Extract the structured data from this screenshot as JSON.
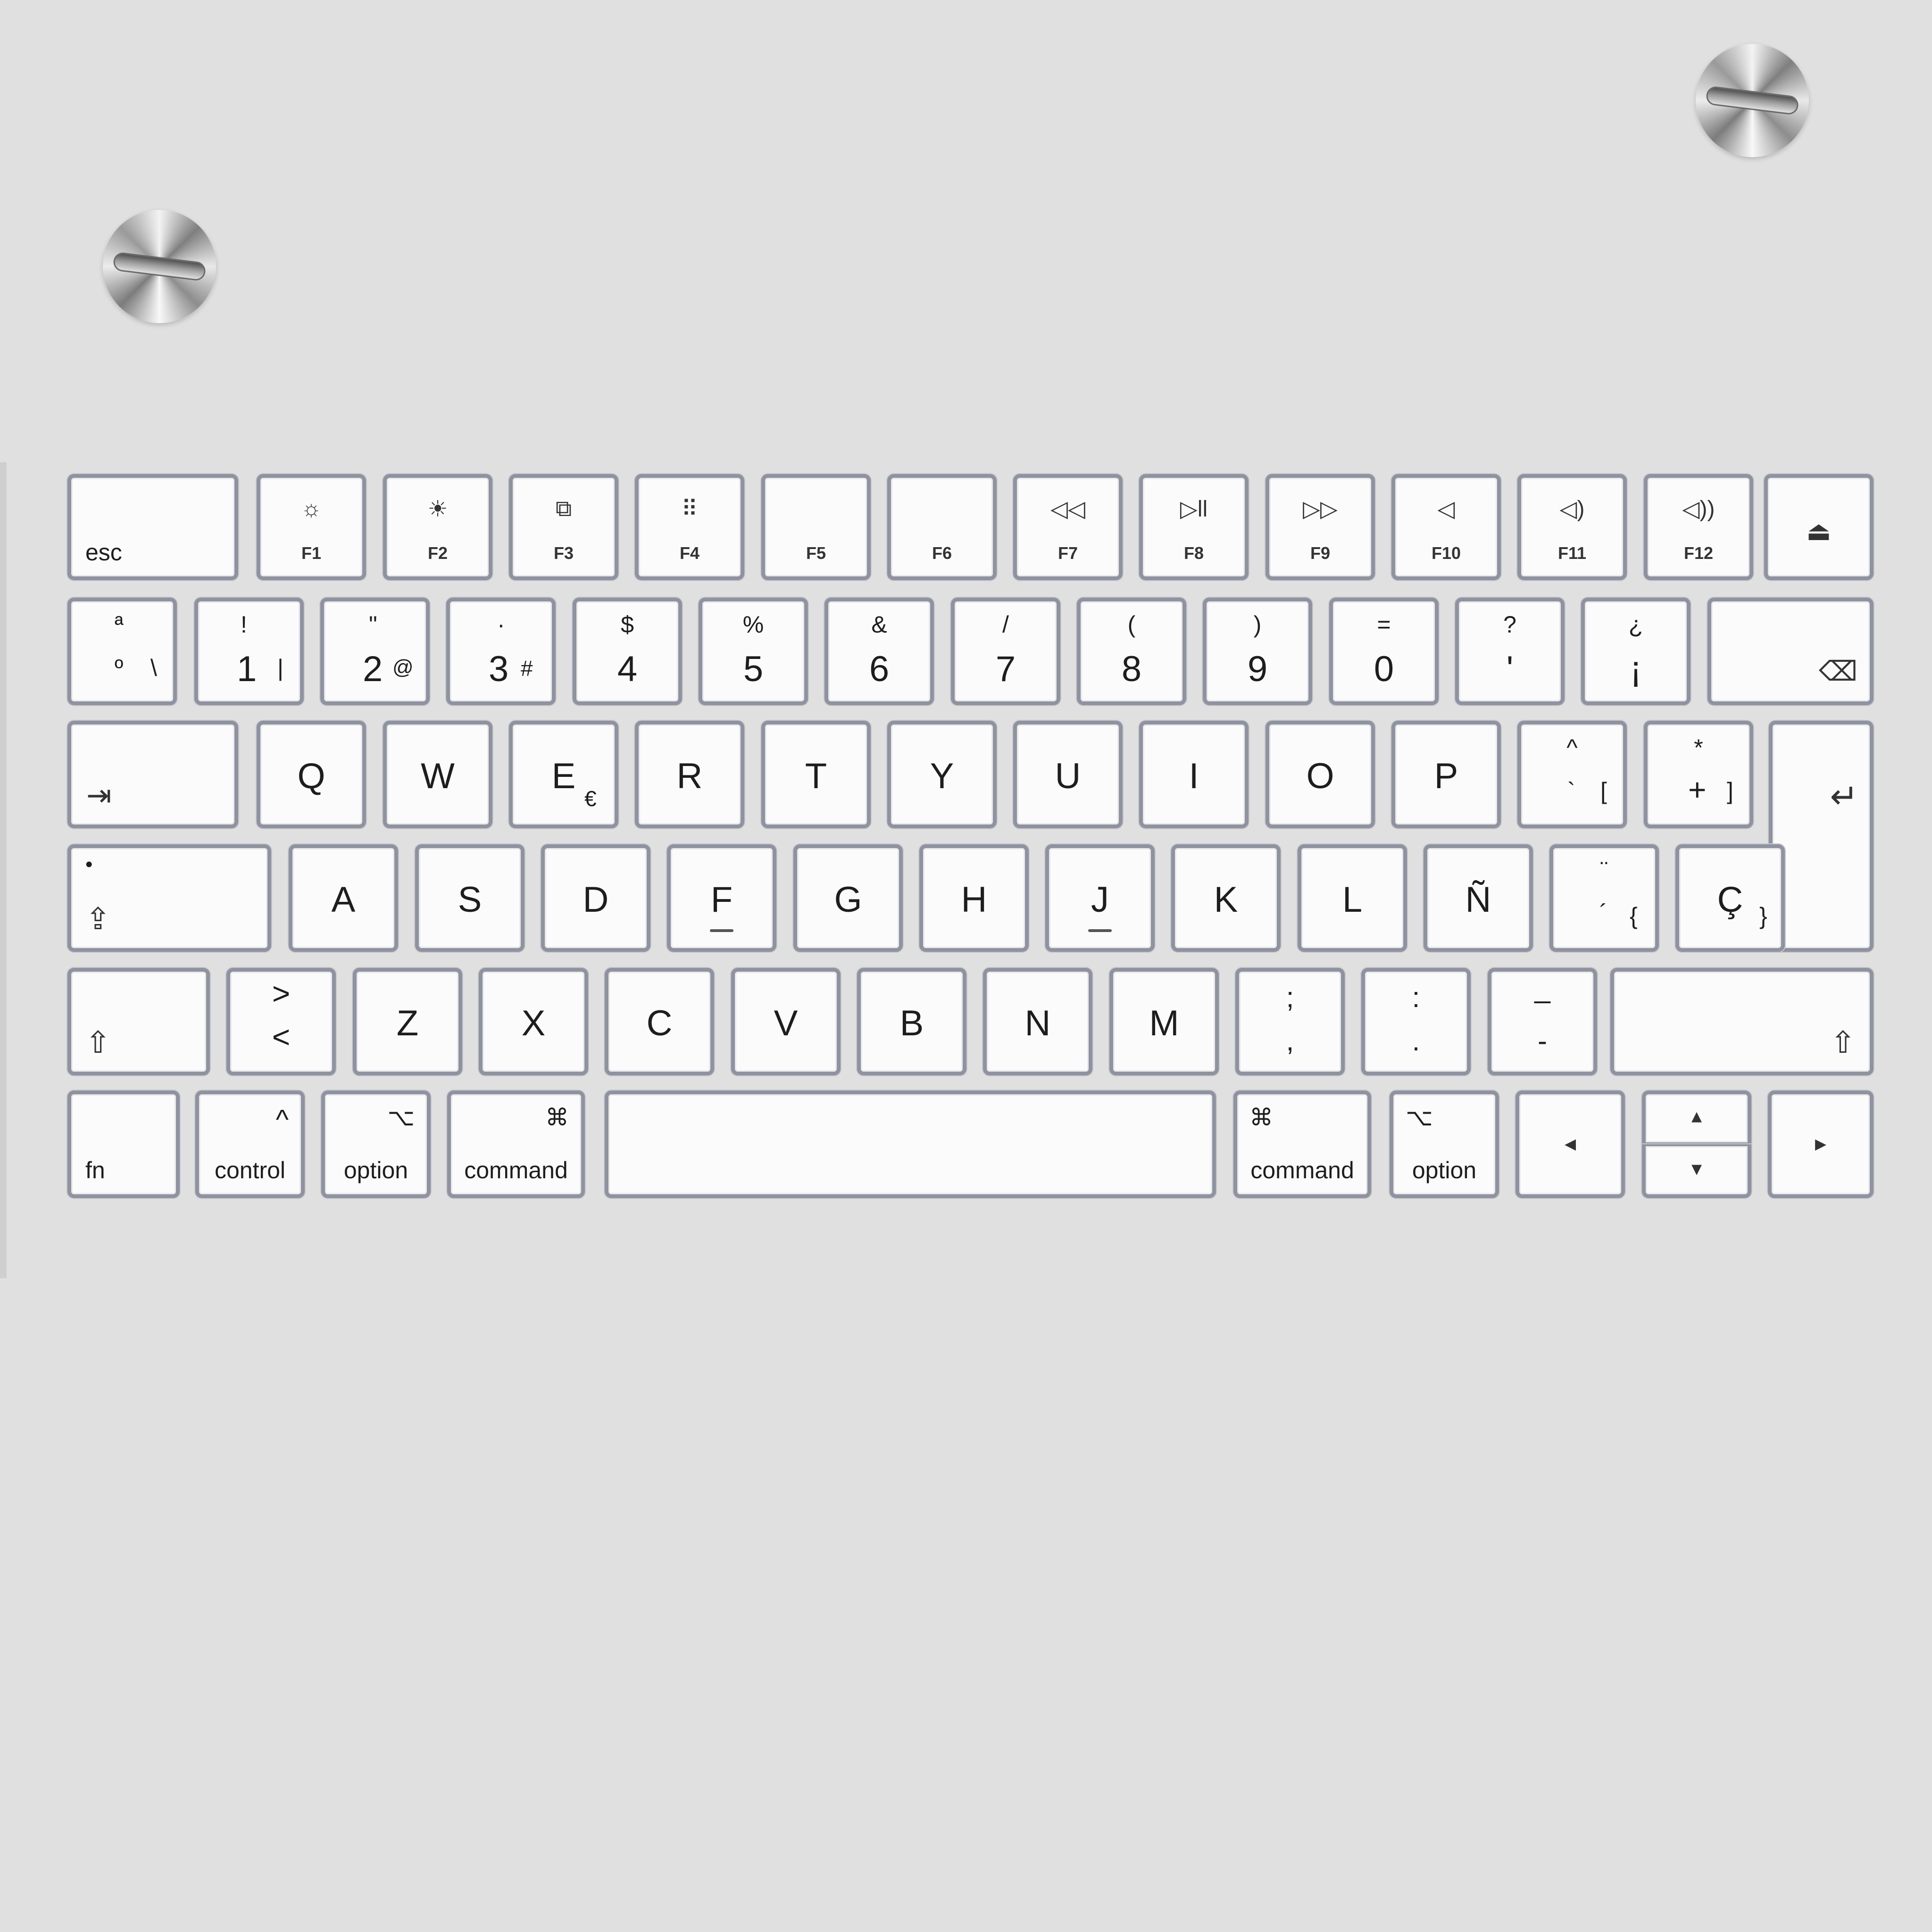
{
  "screws": [
    "screw-icon",
    "screw-icon"
  ],
  "rows": {
    "function": {
      "esc": "esc",
      "f": [
        {
          "icon": "☼",
          "label": "F1"
        },
        {
          "icon": "☀",
          "label": "F2"
        },
        {
          "icon": "⧉",
          "label": "F3"
        },
        {
          "icon": "⠿",
          "label": "F4"
        },
        {
          "icon": "",
          "label": "F5"
        },
        {
          "icon": "",
          "label": "F6"
        },
        {
          "icon": "◁◁",
          "label": "F7"
        },
        {
          "icon": "▷ll",
          "label": "F8"
        },
        {
          "icon": "▷▷",
          "label": "F9"
        },
        {
          "icon": "◁",
          "label": "F10"
        },
        {
          "icon": "◁)",
          "label": "F11"
        },
        {
          "icon": "◁))",
          "label": "F12"
        }
      ],
      "eject": "⏏"
    },
    "number": [
      {
        "top": "ª",
        "bottom": "º",
        "alt": "\\"
      },
      {
        "top": "!",
        "bottom": "1",
        "alt": "|"
      },
      {
        "top": "\"",
        "bottom": "2",
        "alt": "@"
      },
      {
        "top": "·",
        "bottom": "3",
        "alt": "#"
      },
      {
        "top": "$",
        "bottom": "4",
        "alt": ""
      },
      {
        "top": "%",
        "bottom": "5",
        "alt": ""
      },
      {
        "top": "&",
        "bottom": "6",
        "alt": ""
      },
      {
        "top": "/",
        "bottom": "7",
        "alt": ""
      },
      {
        "top": "(",
        "bottom": "8",
        "alt": ""
      },
      {
        "top": ")",
        "bottom": "9",
        "alt": ""
      },
      {
        "top": "=",
        "bottom": "0",
        "alt": ""
      },
      {
        "top": "?",
        "bottom": "'",
        "alt": ""
      },
      {
        "top": "¿",
        "bottom": "¡",
        "alt": ""
      }
    ],
    "delete_icon": "⌫",
    "qwerty": {
      "tab": "⇥",
      "letters": [
        "Q",
        "W",
        "E",
        "R",
        "T",
        "Y",
        "U",
        "I",
        "O",
        "P"
      ],
      "e_alt": "€",
      "grave": {
        "top": "^",
        "bottom": "`",
        "alt": "["
      },
      "plus": {
        "top": "*",
        "bottom": "+",
        "alt": "]"
      },
      "return": "↵"
    },
    "home": {
      "caps_dot": "•",
      "caps": "⇪",
      "letters": [
        "A",
        "S",
        "D",
        "F",
        "G",
        "H",
        "J",
        "K",
        "L",
        "Ñ"
      ],
      "acute": {
        "top": "¨",
        "bottom": "´",
        "alt": "{"
      },
      "cedilla": {
        "main": "Ç",
        "alt": "}"
      }
    },
    "bottom": {
      "shift": "⇧",
      "angle": {
        "top": ">",
        "bottom": "<"
      },
      "letters": [
        "Z",
        "X",
        "C",
        "V",
        "B",
        "N",
        "M"
      ],
      "semicolon": {
        "top": ";",
        "bottom": ","
      },
      "colon": {
        "top": ":",
        "bottom": "."
      },
      "dash": {
        "top": "_",
        "bottom": "-"
      }
    },
    "modifiers": {
      "fn": "fn",
      "control": "control",
      "control_symbol": "^",
      "option": "option",
      "option_symbol": "⌥",
      "command": "command",
      "command_symbol": "⌘",
      "left": "◂",
      "up": "▴",
      "down": "▾",
      "right": "▸"
    }
  }
}
